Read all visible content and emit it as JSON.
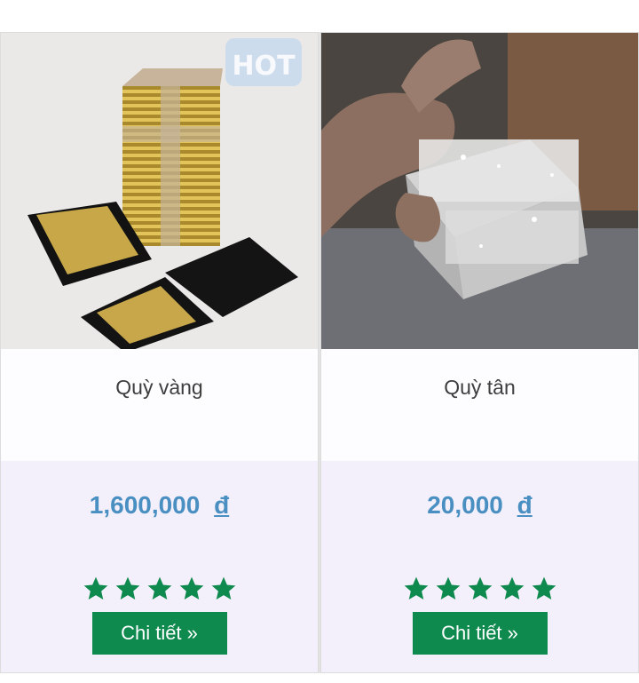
{
  "products": [
    {
      "name": "Quỳ vàng",
      "price": "1,600,000",
      "currency": "đ",
      "rating": 5,
      "button_label": "Chi tiết »",
      "image_desc": "gold-leaf-paper-stack",
      "badge": "HOT"
    },
    {
      "name": "Quỳ tân",
      "price": "20,000",
      "currency": "đ",
      "rating": 5,
      "button_label": "Chi tiết »",
      "image_desc": "silver-leaf-paper-block"
    }
  ],
  "colors": {
    "price": "#4a8fc2",
    "star": "#0f8a4f",
    "button_bg": "#0f8a4f",
    "lower_bg": "#f3f0fb"
  }
}
